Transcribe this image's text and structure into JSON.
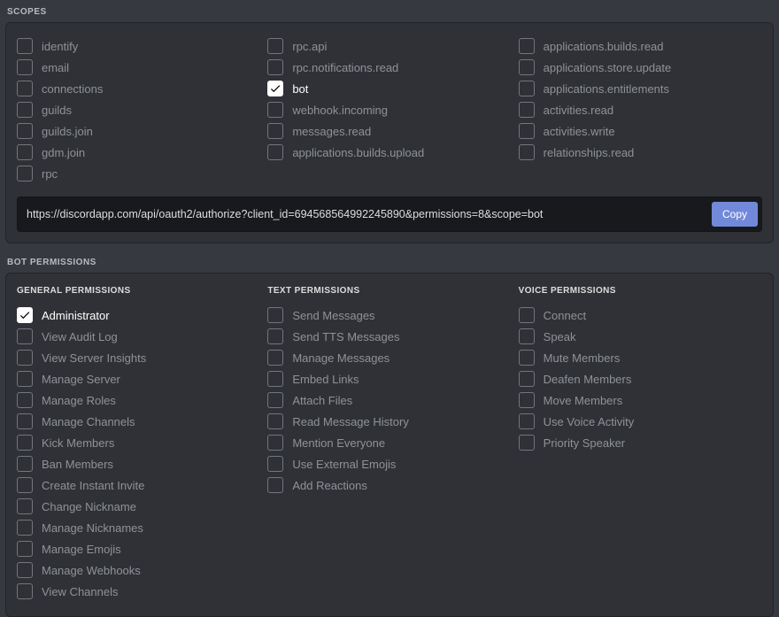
{
  "sections": {
    "scopes": {
      "title": "SCOPES",
      "columns": [
        [
          {
            "label": "identify",
            "checked": false
          },
          {
            "label": "email",
            "checked": false
          },
          {
            "label": "connections",
            "checked": false
          },
          {
            "label": "guilds",
            "checked": false
          },
          {
            "label": "guilds.join",
            "checked": false
          },
          {
            "label": "gdm.join",
            "checked": false
          },
          {
            "label": "rpc",
            "checked": false
          }
        ],
        [
          {
            "label": "rpc.api",
            "checked": false
          },
          {
            "label": "rpc.notifications.read",
            "checked": false
          },
          {
            "label": "bot",
            "checked": true
          },
          {
            "label": "webhook.incoming",
            "checked": false
          },
          {
            "label": "messages.read",
            "checked": false
          },
          {
            "label": "applications.builds.upload",
            "checked": false
          }
        ],
        [
          {
            "label": "applications.builds.read",
            "checked": false
          },
          {
            "label": "applications.store.update",
            "checked": false
          },
          {
            "label": "applications.entitlements",
            "checked": false
          },
          {
            "label": "activities.read",
            "checked": false
          },
          {
            "label": "activities.write",
            "checked": false
          },
          {
            "label": "relationships.read",
            "checked": false
          }
        ]
      ],
      "url": "https://discordapp.com/api/oauth2/authorize?client_id=694568564992245890&permissions=8&scope=bot",
      "copy": "Copy"
    },
    "permissions": {
      "title": "BOT PERMISSIONS",
      "columns": [
        {
          "title": "GENERAL PERMISSIONS",
          "items": [
            {
              "label": "Administrator",
              "checked": true
            },
            {
              "label": "View Audit Log",
              "checked": false
            },
            {
              "label": "View Server Insights",
              "checked": false
            },
            {
              "label": "Manage Server",
              "checked": false
            },
            {
              "label": "Manage Roles",
              "checked": false
            },
            {
              "label": "Manage Channels",
              "checked": false
            },
            {
              "label": "Kick Members",
              "checked": false
            },
            {
              "label": "Ban Members",
              "checked": false
            },
            {
              "label": "Create Instant Invite",
              "checked": false
            },
            {
              "label": "Change Nickname",
              "checked": false
            },
            {
              "label": "Manage Nicknames",
              "checked": false
            },
            {
              "label": "Manage Emojis",
              "checked": false
            },
            {
              "label": "Manage Webhooks",
              "checked": false
            },
            {
              "label": "View Channels",
              "checked": false
            }
          ]
        },
        {
          "title": "TEXT PERMISSIONS",
          "items": [
            {
              "label": "Send Messages",
              "checked": false
            },
            {
              "label": "Send TTS Messages",
              "checked": false
            },
            {
              "label": "Manage Messages",
              "checked": false
            },
            {
              "label": "Embed Links",
              "checked": false
            },
            {
              "label": "Attach Files",
              "checked": false
            },
            {
              "label": "Read Message History",
              "checked": false
            },
            {
              "label": "Mention Everyone",
              "checked": false
            },
            {
              "label": "Use External Emojis",
              "checked": false
            },
            {
              "label": "Add Reactions",
              "checked": false
            }
          ]
        },
        {
          "title": "VOICE PERMISSIONS",
          "items": [
            {
              "label": "Connect",
              "checked": false
            },
            {
              "label": "Speak",
              "checked": false
            },
            {
              "label": "Mute Members",
              "checked": false
            },
            {
              "label": "Deafen Members",
              "checked": false
            },
            {
              "label": "Move Members",
              "checked": false
            },
            {
              "label": "Use Voice Activity",
              "checked": false
            },
            {
              "label": "Priority Speaker",
              "checked": false
            }
          ]
        }
      ]
    }
  }
}
